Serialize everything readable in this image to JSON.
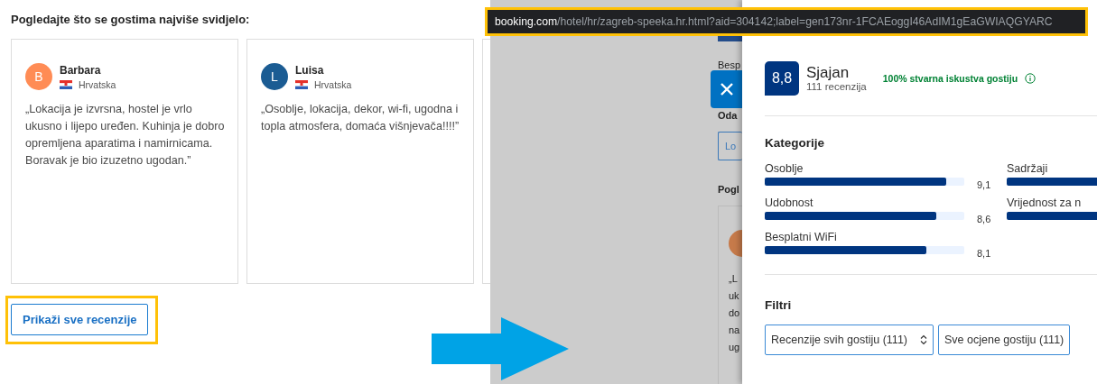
{
  "reviews_section": {
    "heading": "Pogledajte što se gostima najviše svidjelo:",
    "reviews": [
      {
        "initial": "B",
        "color": "#ff8c55",
        "name": "Barbara",
        "country": "Hrvatska",
        "text": "„Lokacija je izvrsna, hostel je vrlo ukusno i lijepo uređen. Kuhinja je dobro opremljena aparatima i namirnicama. Boravak je bio izuzetno ugodan.”"
      },
      {
        "initial": "L",
        "color": "#1b5c93",
        "name": "Luisa",
        "country": "Hrvatska",
        "text": "„Osoblje, lokacija, dekor, wi-fi, ugodna i topla atmosfera, domaća višnjevača!!!!”"
      }
    ],
    "show_all_button": "Prikaži sve recenzije"
  },
  "address_bar": {
    "domain": "booking.com",
    "path": "/hotel/hr/zagreb-speeka.hr.html?aid=304142;label=gen173nr-1FCAEoggI46AdIM1gEaGWIAQGYARC"
  },
  "background_page": {
    "amenity_label": "Besp",
    "section_title": "Oda",
    "button": "Lo",
    "reviews_title": "Pogl",
    "review_lines": [
      "„L",
      "uk",
      "do",
      "na",
      "ug"
    ]
  },
  "review_panel": {
    "score": "8,8",
    "rating_word": "Sjajan",
    "review_count": "111 recenzija",
    "verified_note": "100% stvarna iskustva gostiju",
    "categories_title": "Kategorije",
    "categories": [
      {
        "label": "Osoblje",
        "level": 0.91,
        "score": "9,1"
      },
      {
        "label": "Sadržaji"
      },
      {
        "label": "Udobnost",
        "level": 0.86,
        "score": "8,6"
      },
      {
        "label": "Vrijednost za n"
      },
      {
        "label": "Besplatni WiFi",
        "level": 0.81,
        "score": "8,1"
      }
    ],
    "filters_title": "Filtri",
    "filters": [
      "Recenzije svih gostiju (111)",
      "Sve ocjene gostiju (111)"
    ]
  }
}
